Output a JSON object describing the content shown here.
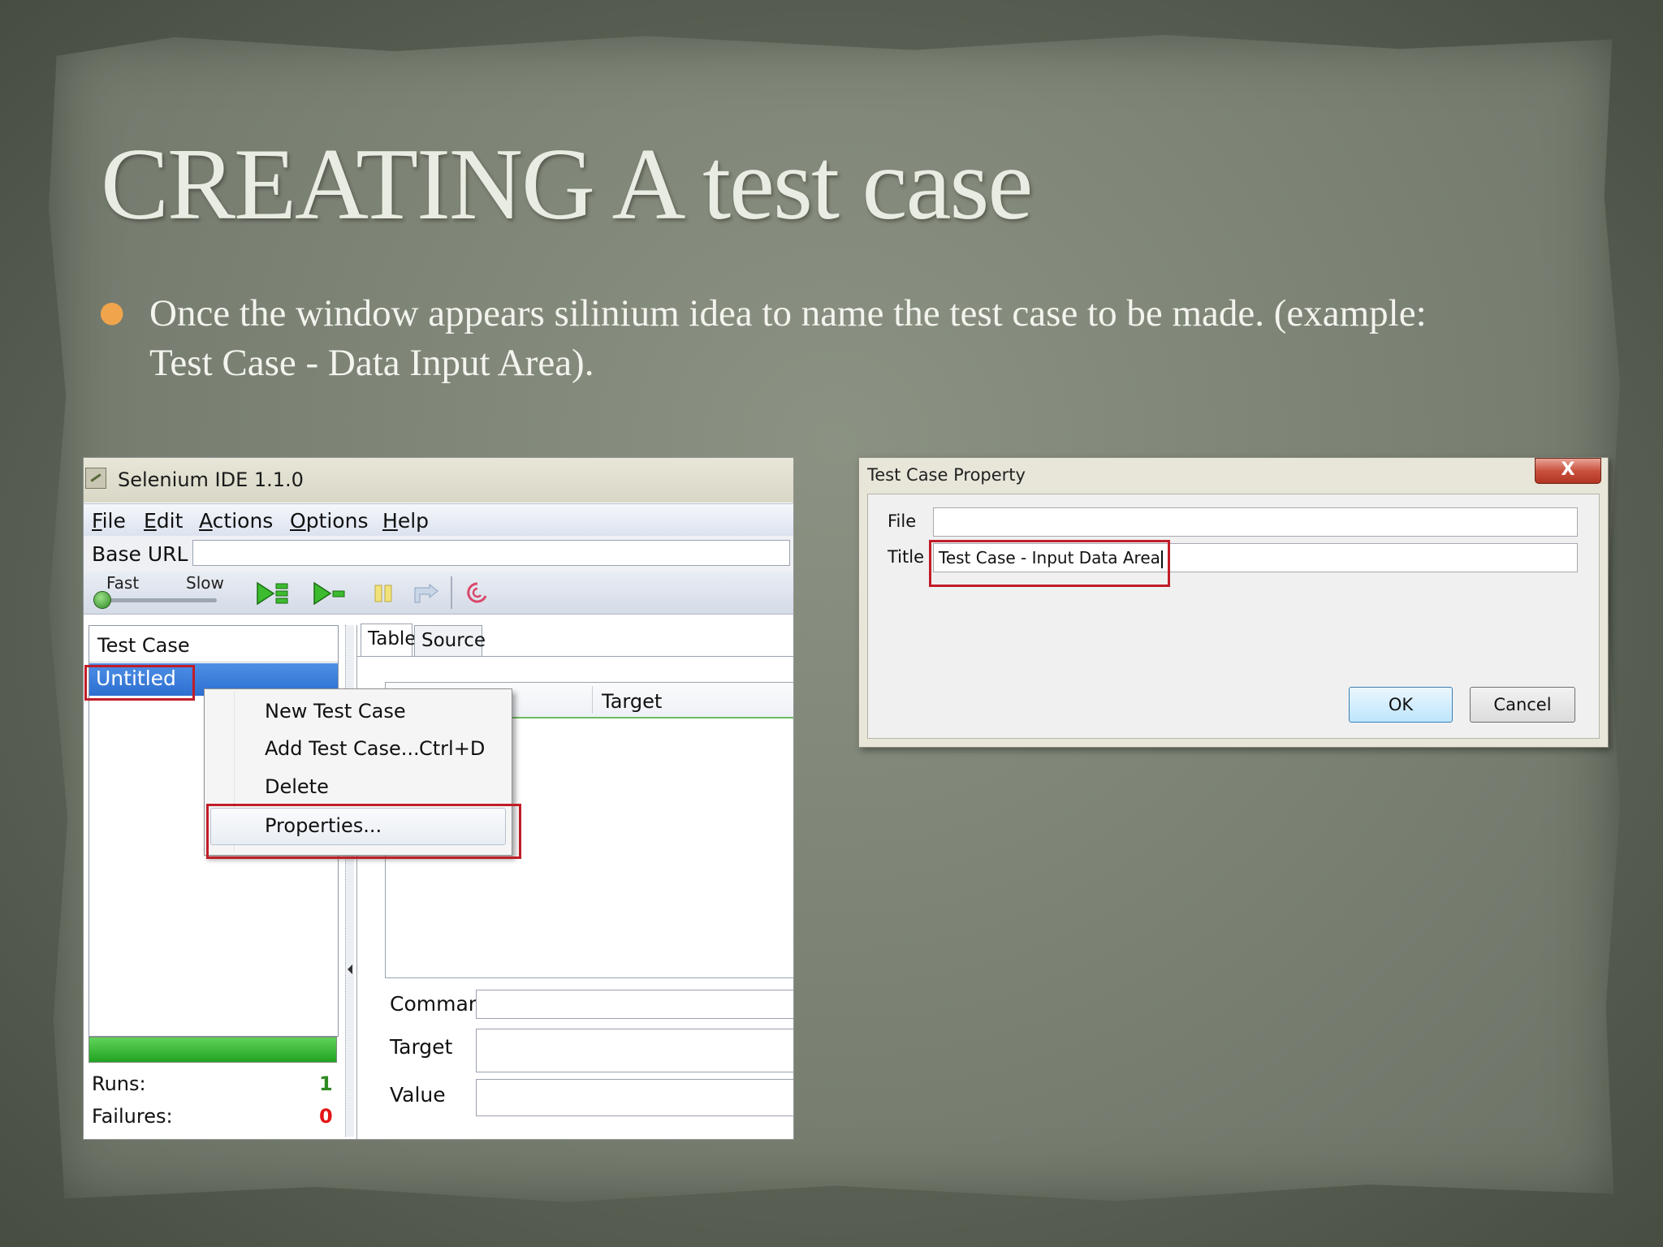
{
  "slide": {
    "title": "CREATING A test case",
    "bullet": "Once the window appears silinium idea to name the test case to be made. (example: Test Case - Data Input Area)."
  },
  "colors": {
    "highlight": "#c01d28",
    "bullet": "#f0a54c",
    "selection": "#3a7bdc",
    "progress": "#22a322",
    "failures": "#e31414",
    "runs": "#2e8a22"
  },
  "ide": {
    "title": "Selenium IDE 1.1.0",
    "menu": [
      "File",
      "Edit",
      "Actions",
      "Options",
      "Help"
    ],
    "base_url_label": "Base URL",
    "base_url_value": "",
    "speed_fast": "Fast",
    "speed_slow": "Slow",
    "toolbar_icons": [
      "play-suite-icon",
      "play-test-icon",
      "pause-icon",
      "step-icon",
      "rollup-icon"
    ],
    "test_case_header": "Test Case",
    "selected_test_case": "Untitled",
    "runs_label": "Runs:",
    "runs_value": "1",
    "failures_label": "Failures:",
    "failures_value": "0",
    "tabs": [
      "Table",
      "Source"
    ],
    "table_header_target": "Target",
    "command_label": "Command",
    "target_label": "Target",
    "value_label": "Value"
  },
  "context_menu": {
    "items": [
      "New Test Case",
      "Add Test Case...",
      "Delete",
      "Properties..."
    ],
    "shortcut_add": "Ctrl+D"
  },
  "dialog": {
    "title": "Test Case Property",
    "close_label": "X",
    "file_label": "File",
    "file_value": "",
    "title_label": "Title",
    "title_value": "Test Case - Input Data Area",
    "ok_label": "OK",
    "cancel_label": "Cancel"
  }
}
